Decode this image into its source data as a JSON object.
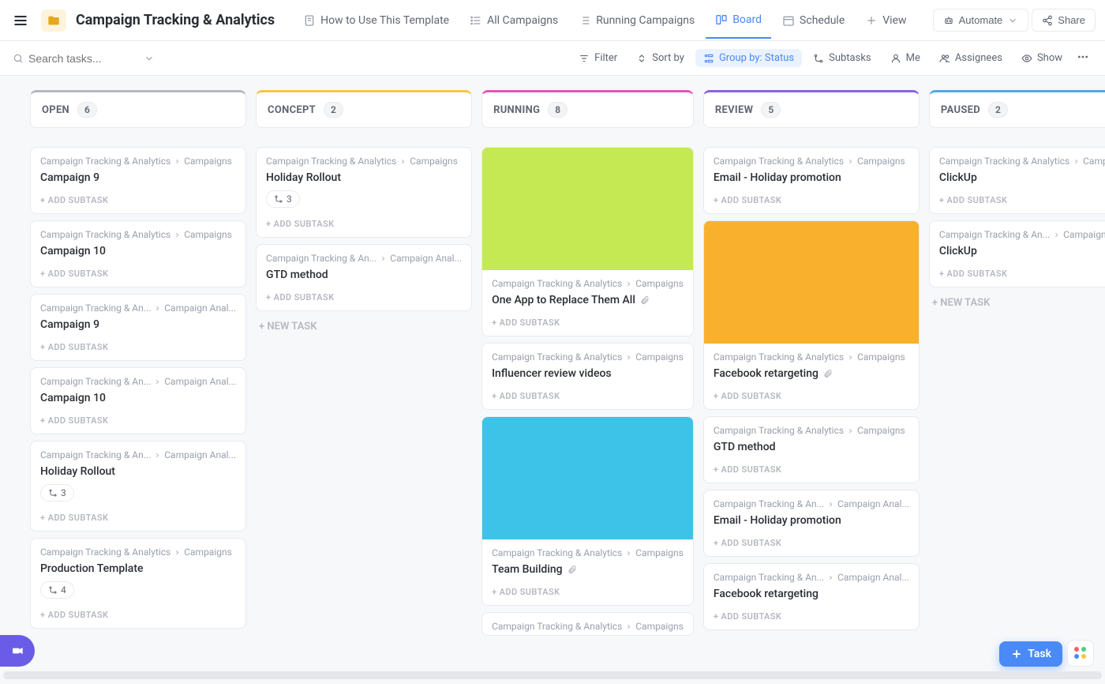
{
  "header": {
    "title": "Campaign Tracking & Analytics",
    "tabs": [
      {
        "label": "How to Use This Template"
      },
      {
        "label": "All Campaigns"
      },
      {
        "label": "Running Campaigns"
      },
      {
        "label": "Board"
      },
      {
        "label": "Schedule"
      },
      {
        "label": "View"
      }
    ],
    "automate": "Automate",
    "share": "Share"
  },
  "toolbar": {
    "search_placeholder": "Search tasks...",
    "filter": "Filter",
    "sort": "Sort by",
    "group": "Group by: Status",
    "subtasks": "Subtasks",
    "me": "Me",
    "assignees": "Assignees",
    "show": "Show"
  },
  "labels": {
    "add_subtask": "+ ADD SUBTASK",
    "new_task": "+ NEW TASK",
    "task_btn": "Task"
  },
  "breadcrumb": {
    "parent": "Campaign Tracking & Analytics",
    "parent_short": "Campaign Tracking & An...",
    "parent_short2": "Campaign Tracking & An...",
    "child": "Campaigns",
    "child_short": "Campaign Anal...",
    "child_short2": "Campaign Anal..."
  },
  "columns": [
    {
      "key": "open",
      "title": "OPEN",
      "count": "6",
      "cards": [
        {
          "bc_parent": "Campaign Tracking & Analytics",
          "bc_child": "Campaigns",
          "title": "Campaign 9"
        },
        {
          "bc_parent": "Campaign Tracking & Analytics",
          "bc_child": "Campaigns",
          "title": "Campaign 10"
        },
        {
          "bc_parent": "Campaign Tracking & An...",
          "bc_child": "Campaign Anal...",
          "title": "Campaign 9"
        },
        {
          "bc_parent": "Campaign Tracking & An...",
          "bc_child": "Campaign Anal...",
          "title": "Campaign 10"
        },
        {
          "bc_parent": "Campaign Tracking & An...",
          "bc_child": "Campaign Anal...",
          "title": "Holiday Rollout",
          "subtask_count": "3"
        },
        {
          "bc_parent": "Campaign Tracking & Analytics",
          "bc_child": "Campaigns",
          "title": "Production Template",
          "subtask_count": "4"
        }
      ]
    },
    {
      "key": "concept",
      "title": "CONCEPT",
      "count": "2",
      "cards": [
        {
          "bc_parent": "Campaign Tracking & Analytics",
          "bc_child": "Campaigns",
          "title": "Holiday Rollout",
          "subtask_count": "3"
        },
        {
          "bc_parent": "Campaign Tracking & An...",
          "bc_child": "Campaign Anal...",
          "title": "GTD method"
        }
      ],
      "show_new_task": true
    },
    {
      "key": "running",
      "title": "RUNNING",
      "count": "8",
      "cards": [
        {
          "bc_parent": "Campaign Tracking & Analytics",
          "bc_child": "Campaigns",
          "title": "One App to Replace Them All",
          "image": "green",
          "attach": true
        },
        {
          "bc_parent": "Campaign Tracking & Analytics",
          "bc_child": "Campaigns",
          "title": "Influencer review videos"
        },
        {
          "bc_parent": "Campaign Tracking & Analytics",
          "bc_child": "Campaigns",
          "title": "Team Building",
          "image": "blue",
          "attach": true
        },
        {
          "bc_parent": "Campaign Tracking & Analytics",
          "bc_child": "Campaigns",
          "title": ""
        }
      ]
    },
    {
      "key": "review",
      "title": "REVIEW",
      "count": "5",
      "cards": [
        {
          "bc_parent": "Campaign Tracking & Analytics",
          "bc_child": "Campaigns",
          "title": "Email - Holiday promotion"
        },
        {
          "bc_parent": "Campaign Tracking & Analytics",
          "bc_child": "Campaigns",
          "title": "Facebook retargeting",
          "image": "orange",
          "attach": true
        },
        {
          "bc_parent": "Campaign Tracking & Analytics",
          "bc_child": "Campaigns",
          "title": "GTD method"
        },
        {
          "bc_parent": "Campaign Tracking & An...",
          "bc_child": "Campaign Anal...",
          "title": "Email - Holiday promotion"
        },
        {
          "bc_parent": "Campaign Tracking & An...",
          "bc_child": "Campaign Anal...",
          "title": "Facebook retargeting"
        }
      ]
    },
    {
      "key": "paused",
      "title": "PAUSED",
      "count": "2",
      "cards": [
        {
          "bc_parent": "Campaign Tracking & Analytics",
          "bc_child": "Campaigns",
          "title": "ClickUp"
        },
        {
          "bc_parent": "Campaign Tracking & An...",
          "bc_child": "Campaign Anal...",
          "title": "ClickUp"
        }
      ],
      "show_new_task": true
    }
  ]
}
